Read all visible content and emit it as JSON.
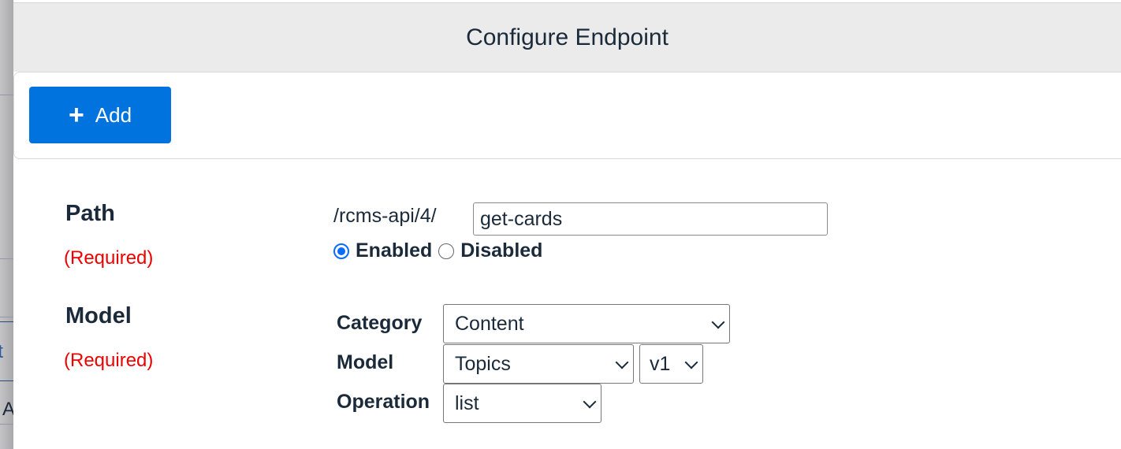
{
  "backdrop": {
    "fragments": [
      "it",
      "A"
    ]
  },
  "modal": {
    "title": "Configure Endpoint",
    "toolbar": {
      "add_label": "Add",
      "add_icon": "plus-icon"
    },
    "path": {
      "label": "Path",
      "required": "(Required)",
      "prefix": "/rcms-api/4/",
      "value": "get-cards",
      "status": {
        "options": [
          "Enabled",
          "Disabled"
        ],
        "selected": "Enabled"
      }
    },
    "model": {
      "label": "Model",
      "required": "(Required)",
      "category_label": "Category",
      "category_value": "Content",
      "model_label": "Model",
      "model_value": "Topics",
      "version_value": "v1",
      "operation_label": "Operation",
      "operation_value": "list"
    }
  },
  "colors": {
    "primary": "#0073de",
    "required": "#ee0000",
    "header_bg": "#ebebeb"
  }
}
